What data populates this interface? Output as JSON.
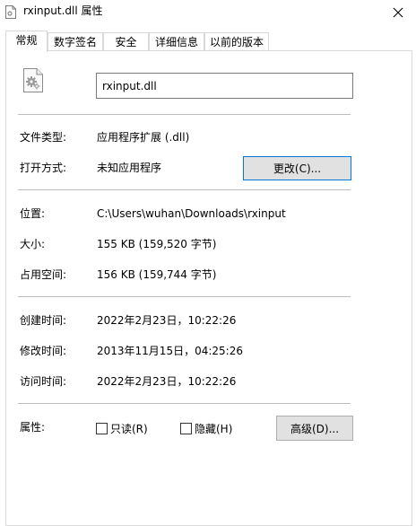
{
  "window": {
    "title": "rxinput.dll 属性",
    "close_glyph": "✕"
  },
  "tabs": [
    {
      "label": "常规",
      "active": true
    },
    {
      "label": "数字签名",
      "active": false
    },
    {
      "label": "安全",
      "active": false
    },
    {
      "label": "详细信息",
      "active": false
    },
    {
      "label": "以前的版本",
      "active": false
    }
  ],
  "general": {
    "file_name": "rxinput.dll",
    "file_type_label": "文件类型:",
    "file_type_value": "应用程序扩展 (.dll)",
    "opens_with_label": "打开方式:",
    "opens_with_value": "未知应用程序",
    "change_button": "更改(C)...",
    "location_label": "位置:",
    "location_value": "C:\\Users\\wuhan\\Downloads\\rxinput",
    "size_label": "大小:",
    "size_value": "155 KB (159,520 字节)",
    "size_on_disk_label": "占用空间:",
    "size_on_disk_value": "156 KB (159,744 字节)",
    "created_label": "创建时间:",
    "created_value": "2022年2月23日，10:22:26",
    "modified_label": "修改时间:",
    "modified_value": "2013年11月15日，04:25:26",
    "accessed_label": "访问时间:",
    "accessed_value": "2022年2月23日，10:22:26",
    "attributes_label": "属性:",
    "readonly_label": "只读(R)",
    "readonly_checked": false,
    "hidden_label": "隐藏(H)",
    "hidden_checked": false,
    "advanced_button": "高级(D)..."
  },
  "icons": {
    "file": "dll-file-icon",
    "close": "close-icon"
  },
  "colors": {
    "focus_border": "#0078d7",
    "button_face": "#e1e1e1",
    "separator": "#bdbdbd"
  }
}
